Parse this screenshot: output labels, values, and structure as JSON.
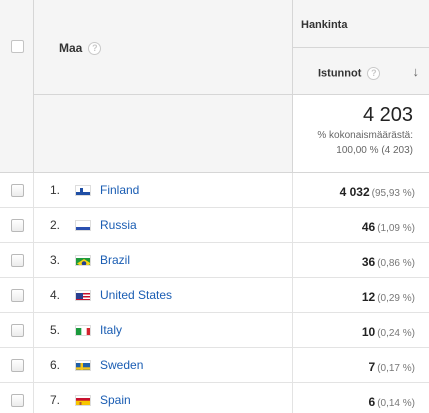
{
  "header": {
    "dimension_label": "Maa",
    "group_label": "Hankinta",
    "metric_label": "Istunnot",
    "help_glyph": "?",
    "sort_glyph": "↓"
  },
  "totals": {
    "value": "4 203",
    "line1": "% kokonaismäärästä:",
    "line2": "100,00 % (4 203)"
  },
  "rows": [
    {
      "index": "1.",
      "country": "Finland",
      "flag": "finland-flag-icon",
      "sessions": "4 032",
      "percent": "(95,93 %)"
    },
    {
      "index": "2.",
      "country": "Russia",
      "flag": "russia-flag-icon",
      "sessions": "46",
      "percent": "(1,09 %)"
    },
    {
      "index": "3.",
      "country": "Brazil",
      "flag": "brazil-flag-icon",
      "sessions": "36",
      "percent": "(0,86 %)"
    },
    {
      "index": "4.",
      "country": "United States",
      "flag": "usa-flag-icon",
      "sessions": "12",
      "percent": "(0,29 %)"
    },
    {
      "index": "5.",
      "country": "Italy",
      "flag": "italy-flag-icon",
      "sessions": "10",
      "percent": "(0,24 %)"
    },
    {
      "index": "6.",
      "country": "Sweden",
      "flag": "sweden-flag-icon",
      "sessions": "7",
      "percent": "(0,17 %)"
    },
    {
      "index": "7.",
      "country": "Spain",
      "flag": "spain-flag-icon",
      "sessions": "6",
      "percent": "(0,14 %)"
    }
  ]
}
